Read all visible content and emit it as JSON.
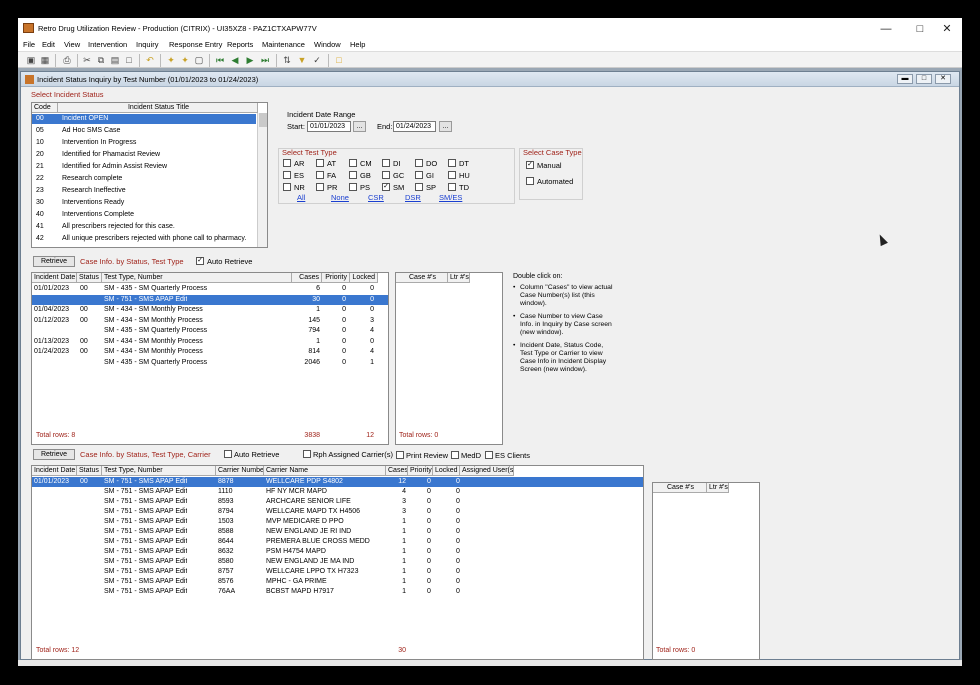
{
  "window": {
    "title": "Retro Drug Utilization Review - Production (CITRIX) - UI35XZ8 - PAZ1CTXAPW77V"
  },
  "menu": [
    "File",
    "Edit",
    "View",
    "Intervention",
    "Inquiry",
    "Response Entry",
    "Reports",
    "Maintenance",
    "Window",
    "Help"
  ],
  "toolbar_icons": [
    "open-icon",
    "save-icon",
    "print-icon",
    "cut-icon",
    "copy-icon",
    "paste-icon",
    "undo-icon",
    "tools-icon",
    "filter-icon",
    "first-icon",
    "prev-icon",
    "next-icon",
    "last-icon",
    "sort-icon",
    "query-icon",
    "execute-icon",
    "folder-icon"
  ],
  "child": {
    "title": "Incident Status Inquiry by Test Number (01/01/2023 to 01/24/2023)"
  },
  "status_section": {
    "label": "Select Incident Status",
    "headers": [
      "Code",
      "Incident Status Title"
    ],
    "rows": [
      {
        "code": "00",
        "title": "Incident OPEN",
        "selected": true
      },
      {
        "code": "05",
        "title": "Ad Hoc SMS Case"
      },
      {
        "code": "10",
        "title": "Intervention In Progress"
      },
      {
        "code": "20",
        "title": "Identified for Phamacist Review"
      },
      {
        "code": "21",
        "title": "Identified for  Admin Assist Review"
      },
      {
        "code": "22",
        "title": "Research complete"
      },
      {
        "code": "23",
        "title": "Research Ineffective"
      },
      {
        "code": "30",
        "title": "Interventions Ready"
      },
      {
        "code": "40",
        "title": "Interventions Complete"
      },
      {
        "code": "41",
        "title": "All prescribers rejected for this case."
      },
      {
        "code": "42",
        "title": "All unique prescribers rejected with phone call to pharmacy."
      }
    ]
  },
  "date_range": {
    "label": "Incident Date Range",
    "start_label": "Start:",
    "start": "01/01/2023",
    "end_label": "End:",
    "end": "01/24/2023",
    "btn": "..."
  },
  "test_type": {
    "label": "Select Test Type",
    "items": [
      {
        "code": "AR",
        "checked": false
      },
      {
        "code": "AT",
        "checked": false
      },
      {
        "code": "CM",
        "checked": false
      },
      {
        "code": "DI",
        "checked": false
      },
      {
        "code": "DO",
        "checked": false
      },
      {
        "code": "DT",
        "checked": false
      },
      {
        "code": "ES",
        "checked": false
      },
      {
        "code": "FA",
        "checked": false
      },
      {
        "code": "GB",
        "checked": false
      },
      {
        "code": "GC",
        "checked": false
      },
      {
        "code": "GI",
        "checked": false
      },
      {
        "code": "HU",
        "checked": false
      },
      {
        "code": "NR",
        "checked": false
      },
      {
        "code": "PR",
        "checked": false
      },
      {
        "code": "PS",
        "checked": false
      },
      {
        "code": "SM",
        "checked": true
      },
      {
        "code": "SP",
        "checked": false
      },
      {
        "code": "TD",
        "checked": false
      }
    ],
    "links": [
      "All",
      "None",
      "CSR",
      "DSR",
      "SM/ES"
    ]
  },
  "case_type": {
    "label": "Select Case Type",
    "manual": "Manual",
    "manual_checked": true,
    "automated": "Automated",
    "automated_checked": false
  },
  "section1": {
    "retrieve": "Retrieve",
    "caption": "Case Info. by Status, Test Type",
    "auto_retrieve": "Auto Retrieve",
    "headers": [
      "Incident Date",
      "Status",
      "Test Type, Number",
      "Cases",
      "Priority",
      "Locked"
    ],
    "rows": [
      {
        "date": "01/01/2023",
        "status": "00",
        "test": "SM - 435 - SM Quarterly Process",
        "cases": "6",
        "priority": "0",
        "locked": "0"
      },
      {
        "date": "",
        "status": "",
        "test": "SM - 751 - SMS APAP Edit",
        "cases": "30",
        "priority": "0",
        "locked": "0",
        "selected": true
      },
      {
        "date": "01/04/2023",
        "status": "00",
        "test": "SM - 434 - SM Monthly Process",
        "cases": "1",
        "priority": "0",
        "locked": "0"
      },
      {
        "date": "01/12/2023",
        "status": "00",
        "test": "SM - 434 - SM Monthly Process",
        "cases": "145",
        "priority": "0",
        "locked": "3"
      },
      {
        "date": "",
        "status": "",
        "test": "SM - 435 - SM Quarterly Process",
        "cases": "794",
        "priority": "0",
        "locked": "4"
      },
      {
        "date": "01/13/2023",
        "status": "00",
        "test": "SM - 434 - SM Monthly Process",
        "cases": "1",
        "priority": "0",
        "locked": "0"
      },
      {
        "date": "01/24/2023",
        "status": "00",
        "test": "SM - 434 - SM Monthly Process",
        "cases": "814",
        "priority": "0",
        "locked": "4"
      },
      {
        "date": "",
        "status": "",
        "test": "SM - 435 - SM Quarterly Process",
        "cases": "2046",
        "priority": "0",
        "locked": "1"
      }
    ],
    "total_label": "Total rows: 8",
    "total_cases": "3838",
    "total_locked": "12",
    "case_headers": [
      "Case #'s",
      "Ltr #'s"
    ],
    "case_total": "Total rows: 0"
  },
  "help": {
    "title": "Double click on:",
    "bullets": [
      "Column \"Cases\" to view actual Case Number(s) list (this window).",
      "Case Number to view Case Info. in Inquiry by Case screen (new window).",
      "Incident Date, Status Code, Test Type or Carrier to view Case Info in Incident Display Screen (new window)."
    ]
  },
  "section2": {
    "retrieve": "Retrieve",
    "caption": "Case Info. by Status, Test Type, Carrier",
    "auto_retrieve": "Auto Retrieve",
    "rph": "Rph Assigned Carrier(s)",
    "print_review": "Print Review",
    "medd": "MedD",
    "es_clients": "ES Clients",
    "headers": [
      "Incident Date",
      "Status",
      "Test Type, Number",
      "Carrier Number",
      "Carrier Name",
      "Cases",
      "Priority",
      "Locked",
      "Assigned User(s)"
    ],
    "rows": [
      {
        "date": "01/01/2023",
        "status": "00",
        "test": "SM - 751 - SMS APAP Edit",
        "carrier": "8878",
        "name": "WELLCARE PDP S4802",
        "cases": "12",
        "priority": "0",
        "locked": "0",
        "selected": true
      },
      {
        "date": "",
        "status": "",
        "test": "SM - 751 - SMS APAP Edit",
        "carrier": "1110",
        "name": "HF NY MCR MAPD",
        "cases": "4",
        "priority": "0",
        "locked": "0"
      },
      {
        "date": "",
        "status": "",
        "test": "SM - 751 - SMS APAP Edit",
        "carrier": "8593",
        "name": "ARCHCARE SENIOR LIFE",
        "cases": "3",
        "priority": "0",
        "locked": "0"
      },
      {
        "date": "",
        "status": "",
        "test": "SM - 751 - SMS APAP Edit",
        "carrier": "8794",
        "name": "WELLCARE MAPD TX H4506",
        "cases": "3",
        "priority": "0",
        "locked": "0"
      },
      {
        "date": "",
        "status": "",
        "test": "SM - 751 - SMS APAP Edit",
        "carrier": "1503",
        "name": "MVP MEDICARE D PPO",
        "cases": "1",
        "priority": "0",
        "locked": "0"
      },
      {
        "date": "",
        "status": "",
        "test": "SM - 751 - SMS APAP Edit",
        "carrier": "8588",
        "name": "NEW ENGLAND JE RI IND",
        "cases": "1",
        "priority": "0",
        "locked": "0"
      },
      {
        "date": "",
        "status": "",
        "test": "SM - 751 - SMS APAP Edit",
        "carrier": "8644",
        "name": "PREMERA BLUE CROSS MEDD",
        "cases": "1",
        "priority": "0",
        "locked": "0"
      },
      {
        "date": "",
        "status": "",
        "test": "SM - 751 - SMS APAP Edit",
        "carrier": "8632",
        "name": "PSM H4754 MAPD",
        "cases": "1",
        "priority": "0",
        "locked": "0"
      },
      {
        "date": "",
        "status": "",
        "test": "SM - 751 - SMS APAP Edit",
        "carrier": "8580",
        "name": "NEW ENGLAND JE MA IND",
        "cases": "1",
        "priority": "0",
        "locked": "0"
      },
      {
        "date": "",
        "status": "",
        "test": "SM - 751 - SMS APAP Edit",
        "carrier": "8757",
        "name": "WELLCARE LPPO TX H7323",
        "cases": "1",
        "priority": "0",
        "locked": "0"
      },
      {
        "date": "",
        "status": "",
        "test": "SM - 751 - SMS APAP Edit",
        "carrier": "8576",
        "name": "MPHC - GA PRIME",
        "cases": "1",
        "priority": "0",
        "locked": "0"
      },
      {
        "date": "",
        "status": "",
        "test": "SM - 751 - SMS APAP Edit",
        "carrier": "76AA",
        "name": "BCBST MAPD H7917",
        "cases": "1",
        "priority": "0",
        "locked": "0"
      }
    ],
    "total_label": "Total rows: 12",
    "total_cases": "30",
    "case_headers": [
      "Case #'s",
      "Ltr #'s"
    ],
    "case_total": "Total rows: 0"
  }
}
